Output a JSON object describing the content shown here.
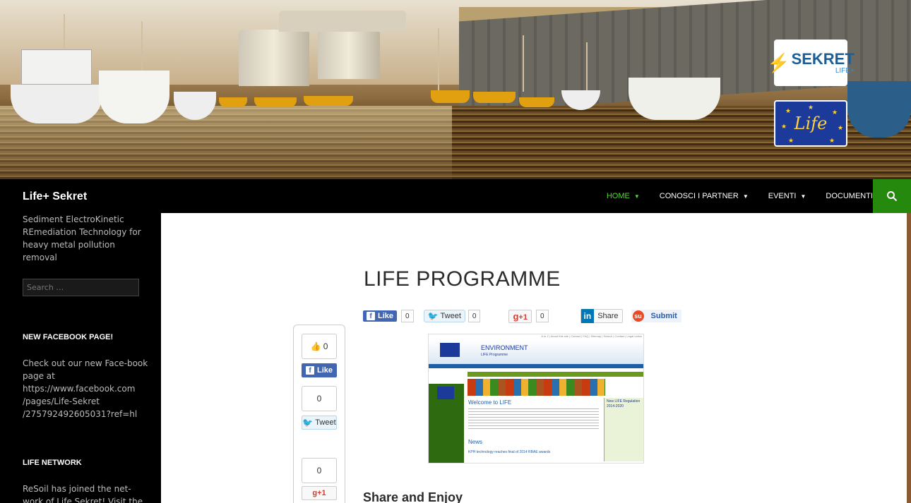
{
  "header": {
    "logo_sekret": "SEKRET",
    "logo_sekret_sub": "LIFE+",
    "logo_life": "Life"
  },
  "site": {
    "title": "Life+ Sekret",
    "tagline": "Sediment ElectroKinetic REmediation Technology for heavy metal pollution removal"
  },
  "nav": {
    "items": [
      {
        "label": "HOME",
        "active": true,
        "has_caret": true
      },
      {
        "label": "CONOSCI I PARTNER",
        "active": false,
        "has_caret": true
      },
      {
        "label": "EVENTI",
        "active": false,
        "has_caret": true
      },
      {
        "label": "DOCUMENTI",
        "active": false,
        "has_caret": false
      }
    ],
    "search_icon": "search-icon"
  },
  "sidebar": {
    "search_placeholder": "Search …",
    "widgets": [
      {
        "title": "NEW FACEBOOK PAGE!",
        "text": "Check out our new Face-book page at https://www.facebook.com /pages/Life-Sekret /275792492605031?ref=hl"
      },
      {
        "title": "LIFE NETWORK",
        "text": "ReSoil has joined the net-work of Life Sekret! Visit the"
      }
    ]
  },
  "content": {
    "title": "LIFE PROGRAMME",
    "share_bar": {
      "fb_like_label": "Like",
      "fb_like_count": "0",
      "tweet_label": "Tweet",
      "tweet_count": "0",
      "gplus_label": "+1",
      "gplus_count": "0",
      "linkedin_label": "Share",
      "stumble_label": "Submit"
    },
    "floating_share": {
      "fb_count": "0",
      "fb_label": "Like",
      "tweet_count": "0",
      "tweet_label": "Tweet",
      "gplus_count": "0",
      "gplus_label": "+1"
    },
    "screenshot": {
      "env_title": "ENVIRONMENT",
      "env_sub": "LIFE Programme",
      "welcome": "Welcome to LIFE",
      "news": "News",
      "news_item": "KPH technology reaches final of 2014 RBAE awards",
      "right_title": "New LIFE Regulation 2014-2020",
      "top_links": "A to Z | About this site | Contact | FAQ | Sitemap | Search | Contact | Legal notice"
    },
    "share_enjoy": "Share and Enjoy"
  },
  "colors": {
    "nav_active": "#55d737",
    "search_button": "#24890d",
    "facebook": "#4267b2",
    "linkedin": "#0077b5"
  }
}
